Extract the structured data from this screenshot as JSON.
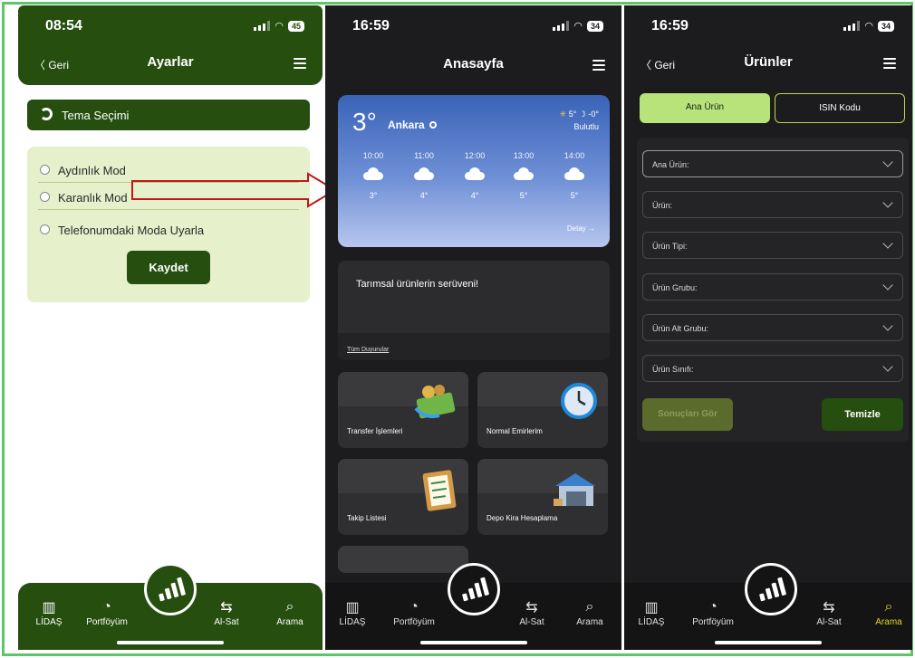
{
  "phone1": {
    "status": {
      "time": "08:54",
      "battery": "45"
    },
    "nav": {
      "back": "〈 Geri",
      "title": "Ayarlar"
    },
    "theme_section": "Tema Seçimi",
    "modes": [
      "Aydınlık Mod",
      "Karanlık Mod",
      "Telefonumdaki Moda Uyarla"
    ],
    "save": "Kaydet"
  },
  "phone2": {
    "status": {
      "time": "16:59",
      "battery": "34"
    },
    "nav": {
      "title": "Anasayfa"
    },
    "weather": {
      "temp": "3°",
      "city": "Ankara",
      "high_low": "5° ☽ -0°",
      "condition": "Bulutlu",
      "hours": [
        {
          "time": "10:00",
          "temp": "3°"
        },
        {
          "time": "11:00",
          "temp": "4°"
        },
        {
          "time": "12:00",
          "temp": "4°"
        },
        {
          "time": "13:00",
          "temp": "5°"
        },
        {
          "time": "14:00",
          "temp": "5°"
        }
      ],
      "detail": "Detay →"
    },
    "news": {
      "text": "Tarımsal ürünlerin serüveni!",
      "all_link": "Tüm Duyurular"
    },
    "cards": [
      "Transfer İşlemleri",
      "Normal Emirlerim",
      "Takip Listesi",
      "Depo Kira Hesaplama"
    ]
  },
  "phone3": {
    "status": {
      "time": "16:59",
      "battery": "34"
    },
    "nav": {
      "back": "〈 Geri",
      "title": "Ürünler"
    },
    "segments": [
      "Ana Ürün",
      "ISIN Kodu"
    ],
    "fields": [
      "Ana Ürün:",
      "Ürün:",
      "Ürün Tipi:",
      "Ürün Grubu:",
      "Ürün Alt Grubu:",
      "Ürün Sınıfı:"
    ],
    "buttons": {
      "results": "Sonuçları Gör",
      "clear": "Temizle"
    }
  },
  "tabs": [
    "LİDAŞ",
    "Portföyüm",
    "Al-Sat",
    "Arama"
  ],
  "colors": {
    "brand_green": "#254e0f",
    "light_green": "#e6f0cb",
    "active_tab": "#e2d32d",
    "annotation_arrow": "#c0181b",
    "frame_border": "#5dc56a"
  }
}
